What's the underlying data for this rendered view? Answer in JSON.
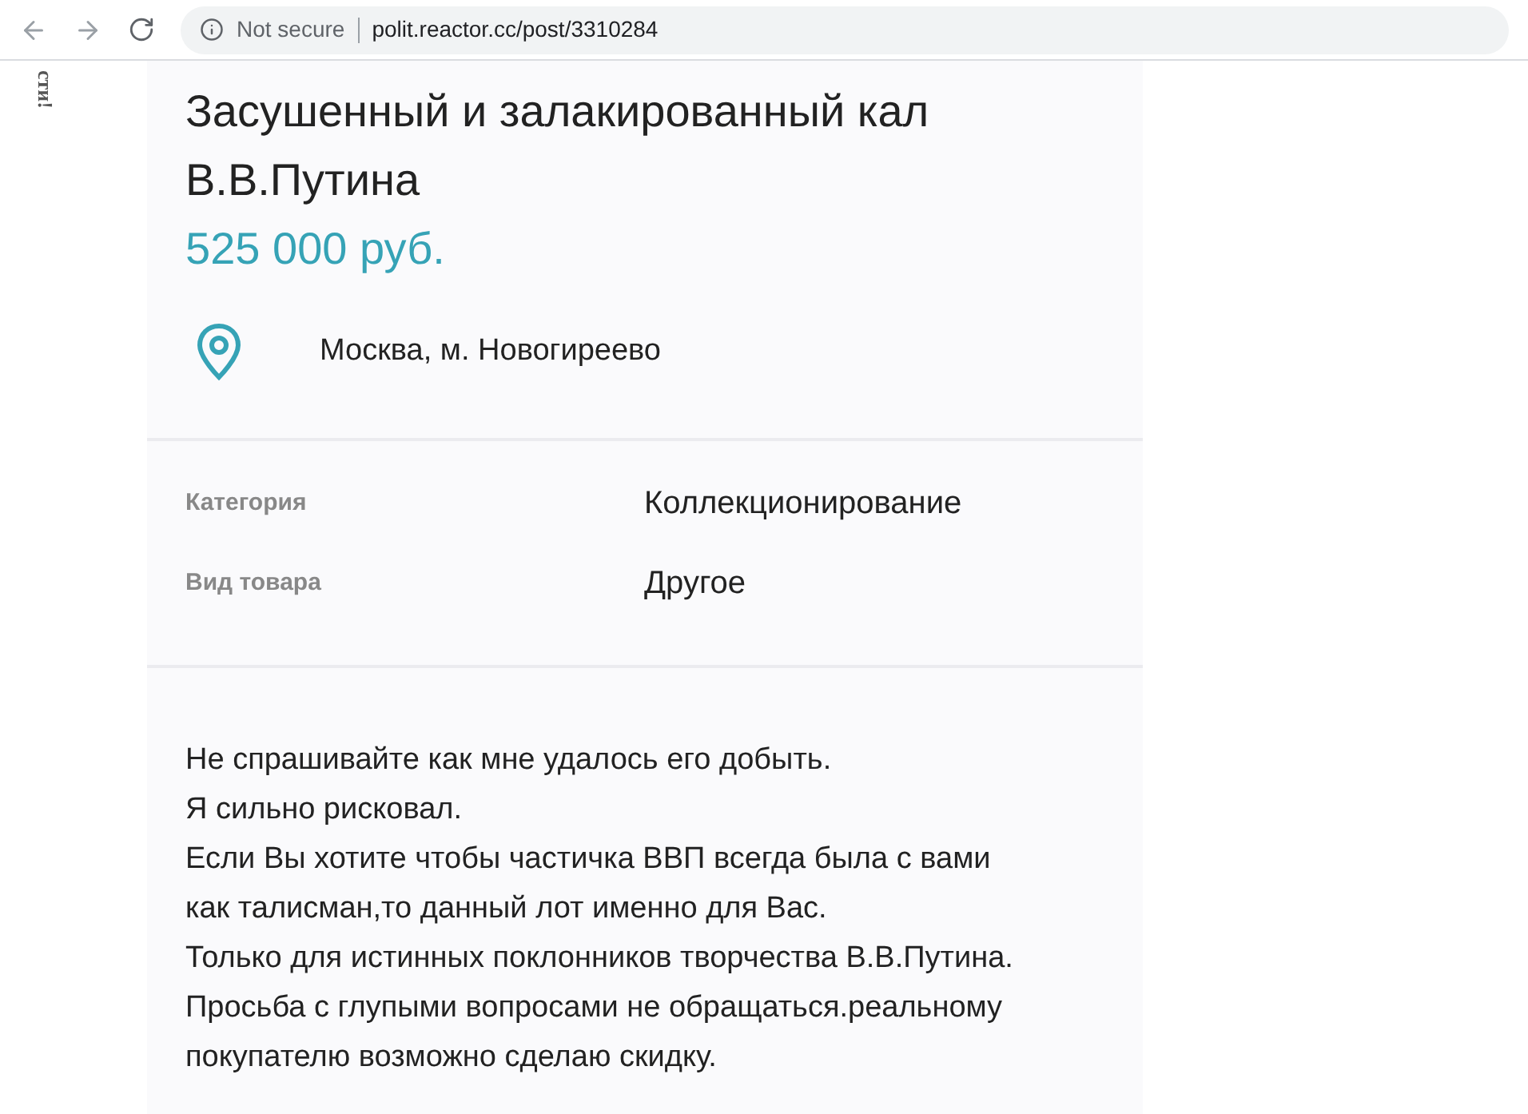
{
  "browser": {
    "security_label": "Not secure",
    "url": "polit.reactor.cc/post/3310284"
  },
  "side_text": "сти!",
  "listing": {
    "title": "Засушенный и залакированный кал В.В.Путина",
    "price": "525 000 руб.",
    "location": "Москва, м. Новогиреево",
    "properties": [
      {
        "label": "Категория",
        "value": "Коллекционирование"
      },
      {
        "label": "Вид товара",
        "value": "Другое"
      }
    ],
    "description": [
      "Не спрашивайте как мне удалось его добыть.",
      "Я сильно рисковал.",
      "Если Вы хотите чтобы частичка ВВП всегда была с вами",
      "как талисман,то данный лот именно для Вас.",
      "Только для истинных поклонников творчества В.В.Путина.",
      "Просьба с глупыми вопросами не обращаться.реальному",
      "покупателю возможно сделаю скидку."
    ]
  }
}
